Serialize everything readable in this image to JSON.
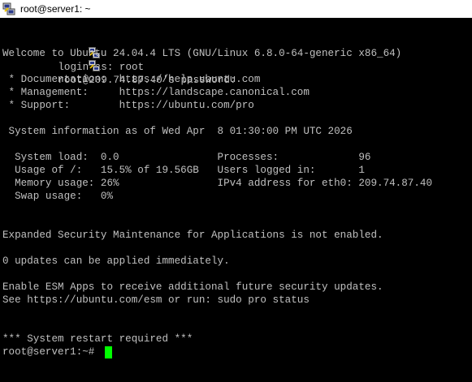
{
  "window": {
    "title": "root@server1: ~",
    "icon": "putty-icon"
  },
  "colors": {
    "terminal_bg": "#000000",
    "terminal_fg": "#c0c0c0",
    "cursor": "#00ff00",
    "titlebar_bg": "#ffffff"
  },
  "terminal": {
    "lines": [
      "login as: root",
      "root@209.74.87.40's password:",
      "Welcome to Ubuntu 24.04.4 LTS (GNU/Linux 6.8.0-64-generic x86_64)",
      "",
      " * Documentation:  https://help.ubuntu.com",
      " * Management:     https://landscape.canonical.com",
      " * Support:        https://ubuntu.com/pro",
      "",
      " System information as of Wed Apr  8 01:30:00 PM UTC 2026",
      "",
      "  System load:  0.0                Processes:             96",
      "  Usage of /:   15.5% of 19.56GB   Users logged in:       1",
      "  Memory usage: 26%                IPv4 address for eth0: 209.74.87.40",
      "  Swap usage:   0%",
      "",
      "",
      "",
      "Expanded Security Maintenance for Applications is not enabled.",
      "",
      "0 updates can be applied immediately.",
      "",
      "Enable ESM Apps to receive additional future security updates.",
      "See https://ubuntu.com/esm or run: sudo pro status",
      "",
      "",
      "*** System restart required ***",
      "root@server1:~# "
    ]
  }
}
